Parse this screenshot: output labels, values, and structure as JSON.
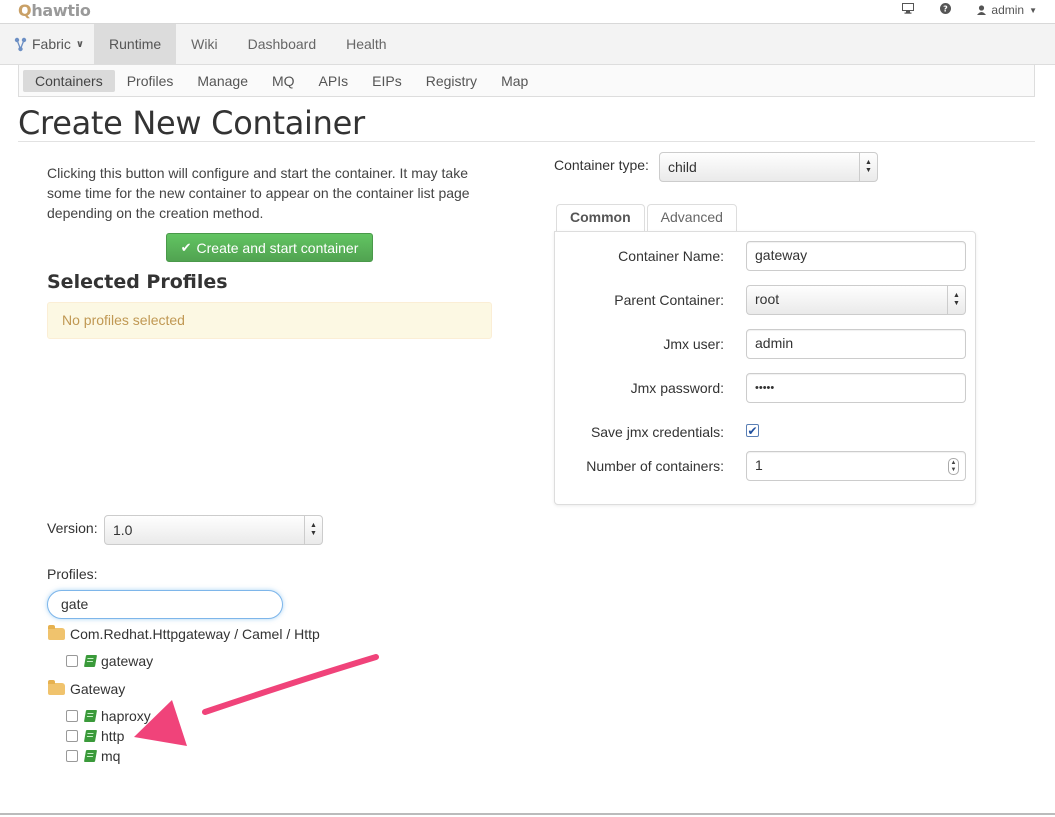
{
  "topbar": {
    "logo": "hawtio",
    "logo_icon": "hawtio-logo",
    "user": "admin",
    "icons": [
      "monitor-icon",
      "help-icon",
      "user-icon"
    ]
  },
  "mainnav": {
    "items": [
      {
        "label": "Fabric",
        "icon": "fabric-icon"
      },
      {
        "label": "Runtime",
        "active": true
      },
      {
        "label": "Wiki"
      },
      {
        "label": "Dashboard"
      },
      {
        "label": "Health"
      }
    ]
  },
  "subnav": {
    "items": [
      {
        "label": "Containers",
        "active": true
      },
      {
        "label": "Profiles"
      },
      {
        "label": "Manage"
      },
      {
        "label": "MQ"
      },
      {
        "label": "APIs"
      },
      {
        "label": "EIPs"
      },
      {
        "label": "Registry"
      },
      {
        "label": "Map"
      }
    ]
  },
  "page": {
    "title": "Create New Container",
    "intro": "Clicking this button will configure and start the container. It may take some time for the new container to appear on the container list page depending on the creation method.",
    "create_button": "Create and start container",
    "selected_profiles_heading": "Selected Profiles",
    "no_profiles": "No profiles selected",
    "version_label": "Version:",
    "version_value": "1.0",
    "profiles_label": "Profiles:",
    "profiles_filter": "gate"
  },
  "tree": {
    "folder1": "Com.Redhat.Httpgateway / Camel / Http",
    "folder1_items": [
      "gateway"
    ],
    "folder2": "Gateway",
    "folder2_items": [
      "haproxy",
      "http",
      "mq"
    ]
  },
  "form": {
    "container_type_label": "Container type:",
    "container_type_value": "child",
    "tabs": [
      {
        "label": "Common",
        "active": true
      },
      {
        "label": "Advanced"
      }
    ],
    "container_name_label": "Container Name:",
    "container_name_value": "gateway",
    "parent_label": "Parent Container:",
    "parent_value": "root",
    "jmx_user_label": "Jmx user:",
    "jmx_user_value": "admin",
    "jmx_password_label": "Jmx password:",
    "jmx_password_value": "•••••",
    "save_creds_label": "Save jmx credentials:",
    "save_creds_checked": true,
    "num_containers_label": "Number of containers:",
    "num_containers_value": "1"
  },
  "colors": {
    "success": "#5bb75b",
    "alert_bg": "#fcf8e3",
    "alert_text": "#c09853",
    "annotation_arrow": "#f0437a"
  }
}
